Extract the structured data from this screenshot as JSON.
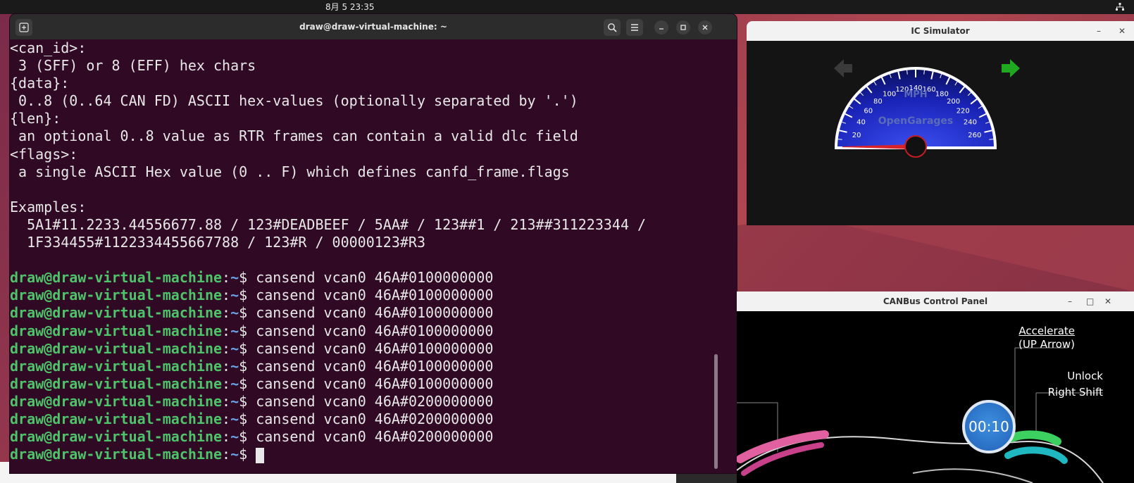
{
  "topbar": {
    "datetime": "8月 5  23:35"
  },
  "terminal": {
    "title": "draw@draw-virtual-machine: ~",
    "output_lines": [
      "<can_id>:",
      " 3 (SFF) or 8 (EFF) hex chars",
      "{data}:",
      " 0..8 (0..64 CAN FD) ASCII hex-values (optionally separated by '.')",
      "{len}:",
      " an optional 0..8 value as RTR frames can contain a valid dlc field",
      "<flags>:",
      " a single ASCII Hex value (0 .. F) which defines canfd_frame.flags",
      "",
      "Examples:",
      "  5A1#11.2233.44556677.88 / 123#DEADBEEF / 5AA# / 123##1 / 213##311223344 /",
      "  1F334455#1122334455667788 / 123#R / 00000123#R3",
      ""
    ],
    "prompt_user": "draw@draw-virtual-machine",
    "prompt_path": "~",
    "prompt_symbol": "$ ",
    "commands": [
      "cansend vcan0 46A#0100000000",
      "cansend vcan0 46A#0100000000",
      "cansend vcan0 46A#0100000000",
      "cansend vcan0 46A#0100000000",
      "cansend vcan0 46A#0100000000",
      "cansend vcan0 46A#0100000000",
      "cansend vcan0 46A#0100000000",
      "cansend vcan0 46A#0200000000",
      "cansend vcan0 46A#0200000000",
      "cansend vcan0 46A#0200000000"
    ]
  },
  "ic_simulator": {
    "title": "IC Simulator",
    "minimize": "–",
    "close": "✕",
    "gauge": {
      "unit": "MPH",
      "brand": "OpenGarages",
      "ticks": [
        "20",
        "40",
        "60",
        "80",
        "100",
        "120",
        "140",
        "160",
        "180",
        "200",
        "220",
        "240",
        "260"
      ],
      "speed": 0
    },
    "left_signal_color": "#3a3a3a",
    "right_signal_color": "#1fa81f"
  },
  "canbus_panel": {
    "title": "CANBus Control Panel",
    "minimize": "–",
    "maximize": "□",
    "close": "✕",
    "accelerate_label": "Accelerate",
    "accelerate_key": "(UP Arrow)",
    "unlock_label": "Unlock",
    "unlock_key": "Right Shift",
    "timer": "00:10"
  },
  "colors": {
    "terminal_bg": "#300a24",
    "prompt_user": "#4ec46a",
    "prompt_path": "#6ba3e8"
  }
}
